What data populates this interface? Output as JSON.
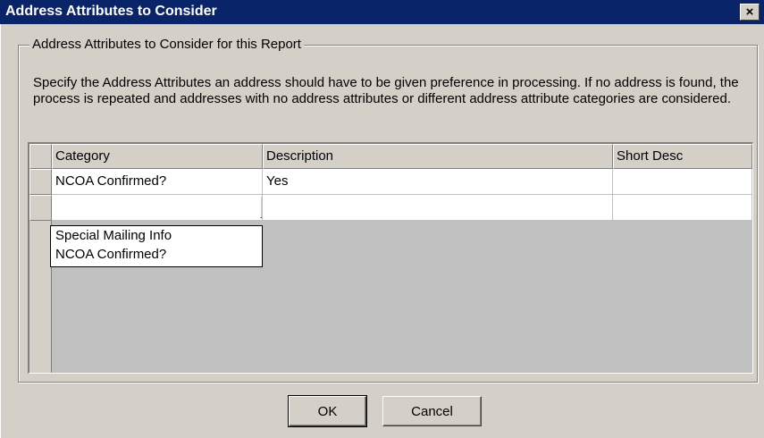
{
  "window": {
    "title": "Address Attributes to Consider",
    "close_glyph": "×"
  },
  "group": {
    "label": "Address Attributes to Consider for this Report",
    "instructions": "Specify the Address Attributes an address should have to be given preference in processing.  If no address is found, the process is repeated and addresses with no address attributes or different address attribute categories are considered."
  },
  "grid": {
    "columns": [
      "Category",
      "Description",
      "Short Desc"
    ],
    "rows": [
      {
        "category": "NCOA Confirmed?",
        "description": "Yes",
        "short_desc": ""
      },
      {
        "category": "",
        "description": "",
        "short_desc": ""
      }
    ],
    "dropdown_options": [
      "Special Mailing Info",
      "NCOA Confirmed?"
    ]
  },
  "buttons": {
    "ok": "OK",
    "cancel": "Cancel"
  },
  "icons": {
    "close": "close-icon",
    "dropdown": "triangle-down-icon"
  }
}
